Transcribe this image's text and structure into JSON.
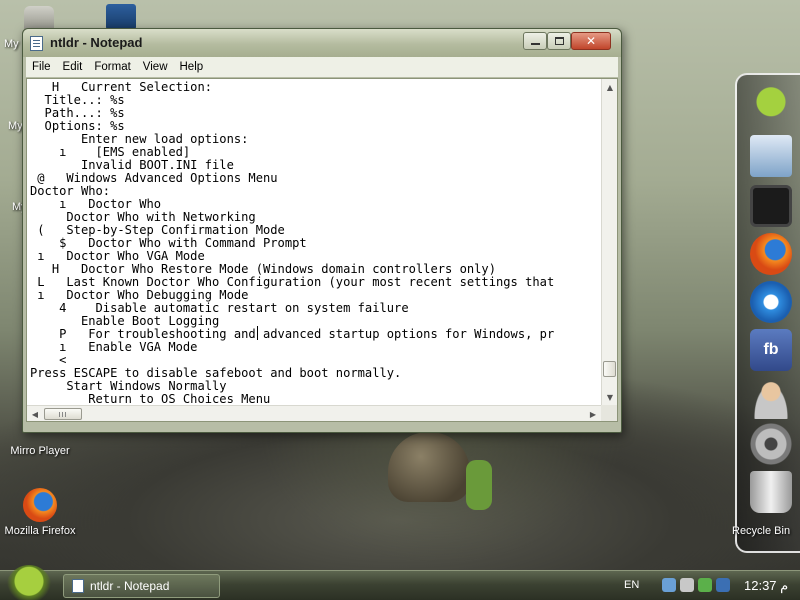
{
  "desktop": {
    "icons": [
      {
        "label": "Mirro Player"
      },
      {
        "label": "Mozilla Firefox"
      }
    ],
    "edge_labels": [
      "My",
      "My",
      "My"
    ]
  },
  "window": {
    "title": "ntldr - Notepad",
    "menu": [
      "File",
      "Edit",
      "Format",
      "View",
      "Help"
    ],
    "lines": [
      "   H   Current Selection:",
      "  Title..: %s",
      "  Path...: %s",
      "  Options: %s",
      "       Enter new load options:",
      "    ı    [EMS enabled]",
      "       Invalid BOOT.INI file",
      " @   Windows Advanced Options Menu",
      "Doctor Who:",
      "    ı   Doctor Who",
      "     Doctor Who with Networking",
      " (   Step-by-Step Confirmation Mode",
      "    $   Doctor Who with Command Prompt",
      " ı   Doctor Who VGA Mode",
      "   H   Doctor Who Restore Mode (Windows domain controllers only)",
      " L   Last Known Doctor Who Configuration (your most recent settings that",
      " ı   Doctor Who Debugging Mode",
      "    4    Disable automatic restart on system failure",
      "       Enable Boot Logging",
      "    P   For troubleshooting and advanced startup options for Windows, pr",
      "    ı   Enable VGA Mode",
      "    <",
      "Press ESCAPE to disable safeboot and boot normally.",
      "     Start Windows Normally",
      "        Return to OS Choices Menu"
    ]
  },
  "dock": {
    "items": [
      "android-icon",
      "network-icon",
      "tablet-icon",
      "firefox-icon",
      "internet-explorer-icon",
      "facebook-icon",
      "support-icon",
      "settings-icon",
      "recycle-bin-icon"
    ],
    "recycle_label": "Recycle Bin"
  },
  "taskbar": {
    "task_label": "ntldr - Notepad",
    "language": "EN",
    "time": "12:37 م"
  },
  "colors": {
    "taskbar": "#3c4232",
    "titlebar": "#b4bb9f",
    "close_button": "#c1452b"
  }
}
